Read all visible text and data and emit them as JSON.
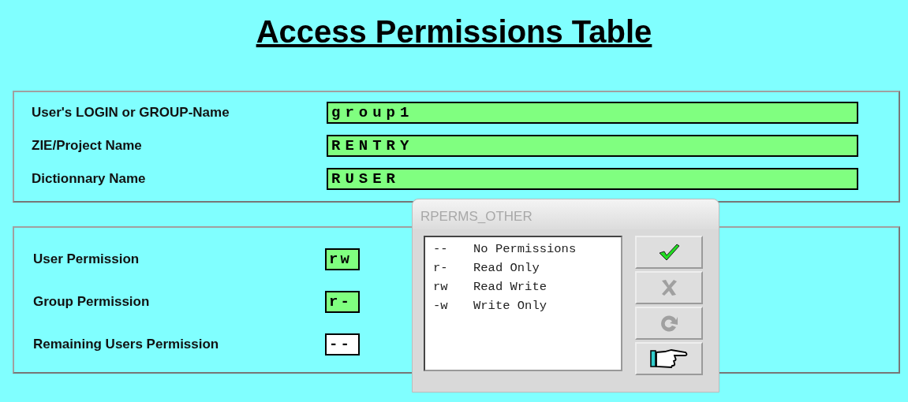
{
  "title": "Access Permissions Table",
  "identity_fields": [
    {
      "label": "User's LOGIN or GROUP-Name",
      "value": "group1"
    },
    {
      "label": "ZIE/Project Name",
      "value": "RENTRY"
    },
    {
      "label": "Dictionnary Name",
      "value": "RUSER"
    }
  ],
  "permission_fields": [
    {
      "label": "User Permission",
      "value": "rw",
      "highlighted": true
    },
    {
      "label": "Group Permission",
      "value": "r-",
      "highlighted": true
    },
    {
      "label": "Remaining Users Permission",
      "value": "--",
      "highlighted": false
    }
  ],
  "popup": {
    "title": "RPERMS_OTHER",
    "options": [
      {
        "code": "--",
        "label": "No Permissions"
      },
      {
        "code": "r-",
        "label": "Read Only"
      },
      {
        "code": "rw",
        "label": "Read Write"
      },
      {
        "code": "-w",
        "label": "Write Only"
      }
    ],
    "buttons": [
      {
        "kind": "ok",
        "disabled": false
      },
      {
        "kind": "cancel",
        "disabled": true
      },
      {
        "kind": "refresh",
        "disabled": true
      },
      {
        "kind": "pointer",
        "disabled": false
      }
    ]
  }
}
